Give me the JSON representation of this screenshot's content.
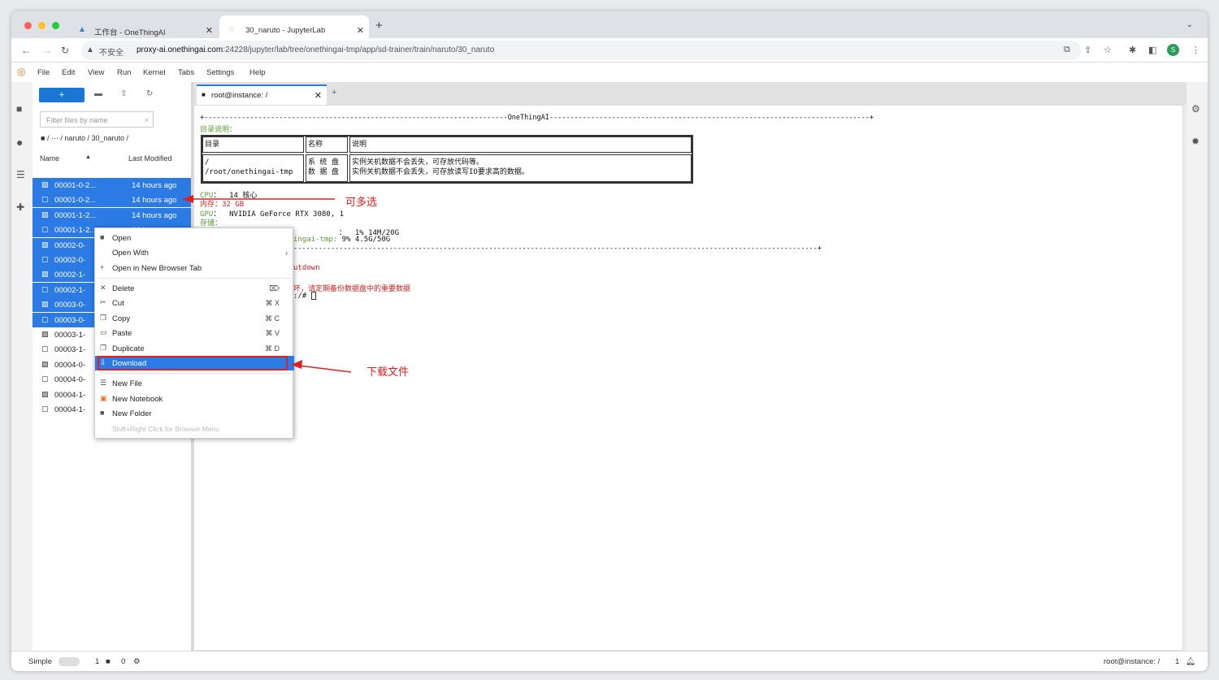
{
  "browser": {
    "tabs": [
      {
        "title": "工作台 - OneThingAI",
        "active": false
      },
      {
        "title": "30_naruto - JupyterLab",
        "active": true
      }
    ],
    "insecure_label": "不安全",
    "url_host": "proxy-ai.onethingai.com",
    "url_rest": ":24228/jupyter/lab/tree/onethingai-tmp/app/sd-trainer/train/naruto/30_naruto",
    "avatar": "S"
  },
  "menu": [
    "File",
    "Edit",
    "View",
    "Run",
    "Kernel",
    "Tabs",
    "Settings",
    "Help"
  ],
  "filebrowser": {
    "filter_placeholder": "Filter files by name",
    "breadcrumb": "/ ··· / naruto / 30_naruto /",
    "col_name": "Name",
    "col_modified": "Last Modified",
    "files": [
      {
        "name": "00001-0-2...",
        "modified": "14 hours ago",
        "type": "image",
        "selected": true
      },
      {
        "name": "00001-0-2...",
        "modified": "14 hours ago",
        "type": "file",
        "selected": true
      },
      {
        "name": "00001-1-2...",
        "modified": "14 hours ago",
        "type": "image",
        "selected": true
      },
      {
        "name": "00001-1-2...",
        "modified": "14 hours ago",
        "type": "file",
        "selected": true
      },
      {
        "name": "00002-0-",
        "modified": "",
        "type": "image",
        "selected": true
      },
      {
        "name": "00002-0-",
        "modified": "",
        "type": "file",
        "selected": true
      },
      {
        "name": "00002-1-",
        "modified": "",
        "type": "image",
        "selected": true
      },
      {
        "name": "00002-1-",
        "modified": "",
        "type": "file",
        "selected": true
      },
      {
        "name": "00003-0-",
        "modified": "",
        "type": "image",
        "selected": true
      },
      {
        "name": "00003-0-",
        "modified": "",
        "type": "file",
        "selected": true
      },
      {
        "name": "00003-1-",
        "modified": "",
        "type": "image",
        "selected": false
      },
      {
        "name": "00003-1-",
        "modified": "",
        "type": "file",
        "selected": false
      },
      {
        "name": "00004-0-",
        "modified": "",
        "type": "image",
        "selected": false
      },
      {
        "name": "00004-0-",
        "modified": "",
        "type": "file",
        "selected": false
      },
      {
        "name": "00004-1-",
        "modified": "",
        "type": "image",
        "selected": false
      },
      {
        "name": "00004-1-",
        "modified": "",
        "type": "file",
        "selected": false
      }
    ]
  },
  "main_tab": "root@instance: /",
  "terminal": {
    "banner": "+-------------------------------------------------------------------------OneThingAI-----------------------------------------------------------------------------+",
    "dir_label": "目录说明：",
    "table": {
      "headers": [
        "目录",
        "名称",
        "说明"
      ],
      "dirs": "/\n/root/onethingai-tmp",
      "names": "系 统 盘\n数 据 盘",
      "descs": "实例关机数据不会丢失，可存放代码等。\n实例关机数据不会丢失，可存放读写IO要求高的数据。"
    },
    "cpu_label": "CPU",
    "cpu_value": "：  14 核心",
    "mem_label": "内存：",
    "mem_value": "32 GB",
    "gpu_label": "GPU",
    "gpu_value": "：  NVIDIA GeForce RTX 3080, 1",
    "storage_label": "存储：",
    "sys_disk": "：  1% 14M/20G",
    "data_disk_label": "ingai-tmp:",
    "data_disk": " 9% 4.5G/50G",
    "banner_end": "------------------------------------------------------------------------------------------------------------------------------+",
    "shutdown": "utdown",
    "warning": "坏，请定期备份数据盘中的重要数据",
    "prompt": ":/# "
  },
  "context_menu": [
    {
      "label": "Open",
      "icon": "folder-icon",
      "shortcut": ""
    },
    {
      "label": "Open With",
      "icon": "",
      "shortcut": "›"
    },
    {
      "label": "Open in New Browser Tab",
      "icon": "plus-icon",
      "shortcut": ""
    },
    {
      "label": "Delete",
      "icon": "close-icon",
      "shortcut": "⌦"
    },
    {
      "label": "Cut",
      "icon": "scissors-icon",
      "shortcut": "⌘ X"
    },
    {
      "label": "Copy",
      "icon": "copy-icon",
      "shortcut": "⌘ C"
    },
    {
      "label": "Paste",
      "icon": "paste-icon",
      "shortcut": "⌘ V"
    },
    {
      "label": "Duplicate",
      "icon": "duplicate-icon",
      "shortcut": "⌘ D"
    },
    {
      "label": "Download",
      "icon": "download-icon",
      "shortcut": ""
    },
    {
      "label": "New File",
      "icon": "file-icon",
      "shortcut": ""
    },
    {
      "label": "New Notebook",
      "icon": "notebook-icon",
      "shortcut": ""
    },
    {
      "label": "New Folder",
      "icon": "folder-icon",
      "shortcut": ""
    }
  ],
  "context_hint": "Shift+Right Click for Browser Menu",
  "annotations": {
    "multi_select": "可多选",
    "download_file": "下载文件",
    "color": "#e02020"
  },
  "status": {
    "mode": "Simple",
    "count1": "1",
    "count2": "0",
    "terminal_name": "root@instance: /",
    "right_count": "1"
  }
}
